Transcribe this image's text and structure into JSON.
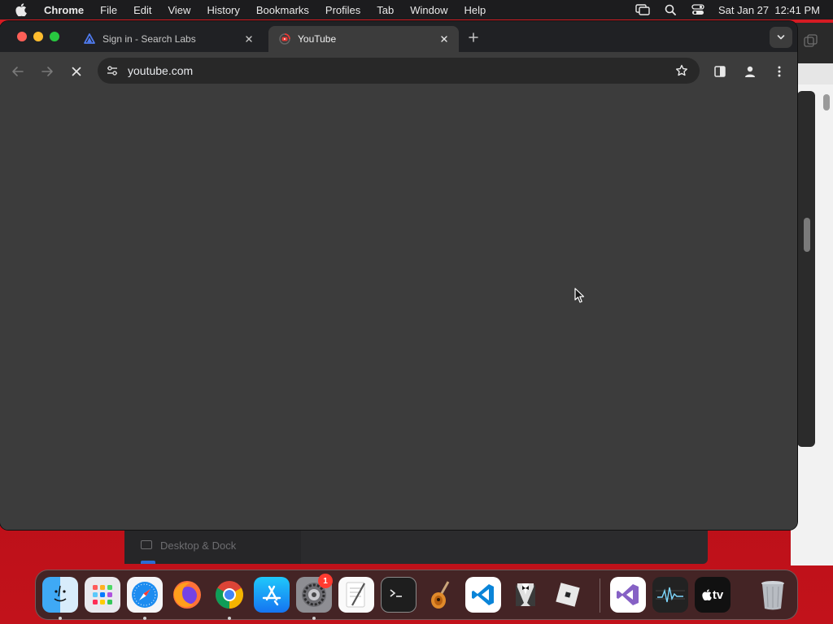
{
  "menubar": {
    "app_name": "Chrome",
    "items": [
      "File",
      "Edit",
      "View",
      "History",
      "Bookmarks",
      "Profiles",
      "Tab",
      "Window",
      "Help"
    ],
    "clock": "Sat Jan 27  12:41 PM",
    "icons": [
      "apple-icon",
      "screen-mirroring-icon",
      "spotlight-search-icon",
      "control-center-icon"
    ]
  },
  "browser": {
    "tabs": [
      {
        "title": "Sign in - Search Labs",
        "favicon": "search-labs-icon",
        "active": false
      },
      {
        "title": "YouTube",
        "favicon": "youtube-icon",
        "active": true
      }
    ],
    "url": "youtube.com",
    "loading": true
  },
  "background_window": {
    "sidebar_item": "Desktop & Dock"
  },
  "dock": {
    "apps": [
      {
        "name": "Finder",
        "icon": "finder-icon",
        "running": true
      },
      {
        "name": "Launchpad",
        "icon": "launchpad-icon",
        "running": false
      },
      {
        "name": "Safari",
        "icon": "safari-icon",
        "running": true
      },
      {
        "name": "Firefox",
        "icon": "firefox-icon",
        "running": false
      },
      {
        "name": "Google Chrome",
        "icon": "chrome-icon",
        "running": true
      },
      {
        "name": "App Store",
        "icon": "app-store-icon",
        "running": false
      },
      {
        "name": "System Settings",
        "icon": "system-settings-icon",
        "running": true,
        "badge": "1"
      },
      {
        "name": "TextEdit",
        "icon": "textedit-icon",
        "running": false
      },
      {
        "name": "Terminal",
        "icon": "terminal-icon",
        "running": false
      },
      {
        "name": "GarageBand",
        "icon": "garageband-icon",
        "running": false
      },
      {
        "name": "Visual Studio Code",
        "icon": "vscode-icon",
        "running": false
      },
      {
        "name": "Bartender",
        "icon": "bartender-icon",
        "running": false
      },
      {
        "name": "Roblox",
        "icon": "roblox-icon",
        "running": false
      },
      {
        "name": "Visual Studio",
        "icon": "visual-studio-icon",
        "running": false
      },
      {
        "name": "Activity Monitor",
        "icon": "activity-monitor-icon",
        "running": false
      },
      {
        "name": "Apple TV",
        "icon": "apple-tv-icon",
        "running": false
      },
      {
        "name": "Trash",
        "icon": "trash-icon",
        "running": false
      }
    ],
    "appletv_label": "tv"
  },
  "colors": {
    "wallpaper": "#c8111a",
    "chrome_frame": "#202124",
    "chrome_toolbar": "#3c3c3c",
    "omnibox": "#282828"
  }
}
